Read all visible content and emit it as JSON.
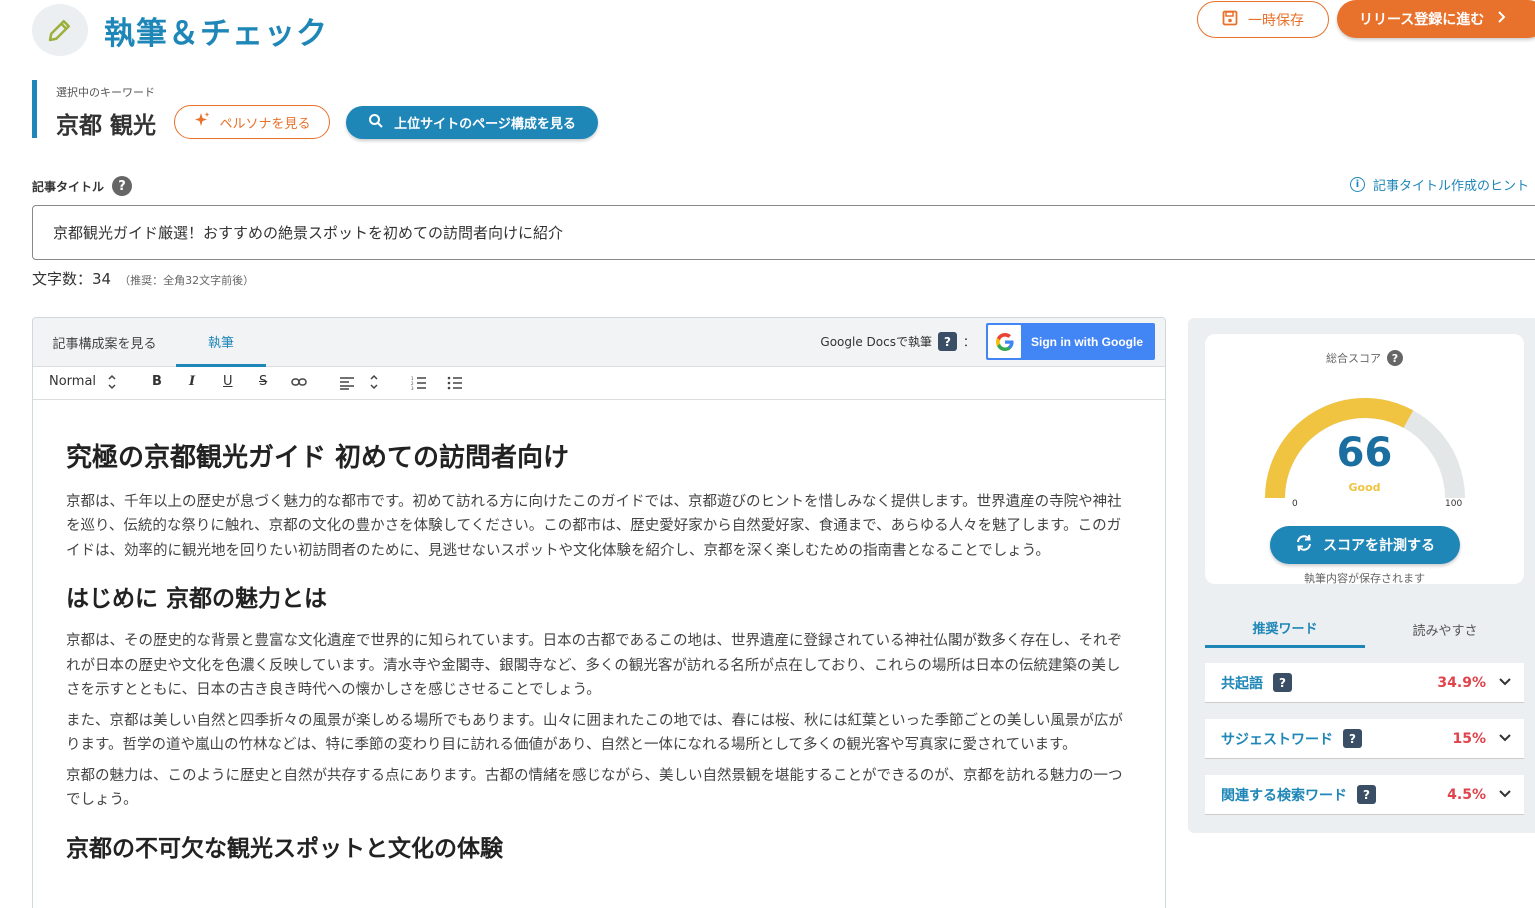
{
  "header": {
    "title": "執筆＆チェック",
    "save_label": "一時保存",
    "release_label": "リリース登録に進む"
  },
  "keyword": {
    "label": "選択中のキーワード",
    "value": "京都 観光",
    "persona_button": "ペルソナを見る",
    "structure_button": "上位サイトのページ構成を見る"
  },
  "title_field": {
    "label": "記事タイトル",
    "help": "?",
    "hint_link": "記事タイトル作成のヒント",
    "value": "京都観光ガイド厳選！おすすめの絶景スポットを初めての訪問者向けに紹介",
    "count_label": "文字数：34",
    "count_note": "（推奨：全角32文字前後）"
  },
  "editor": {
    "tabs": [
      "記事構成案を見る",
      "執筆"
    ],
    "gdocs_label": "Google Docsで執筆",
    "gdocs_help": "?",
    "gdocs_colon": "：",
    "google_signin": "Sign in with Google",
    "toolbar": {
      "style": "Normal",
      "bold": "B",
      "italic": "I",
      "underline": "U",
      "strike": "S"
    },
    "content": {
      "h1": "究極の京都観光ガイド 初めての訪問者向け",
      "p1": "京都は、千年以上の歴史が息づく魅力的な都市です。初めて訪れる方に向けたこのガイドでは、京都遊びのヒントを惜しみなく提供します。世界遺産の寺院や神社を巡り、伝統的な祭りに触れ、京都の文化の豊かさを体験してください。この都市は、歴史愛好家から自然愛好家、食通まで、あらゆる人々を魅了します。このガイドは、効率的に観光地を回りたい初訪問者のために、見逃せないスポットや文化体験を紹介し、京都を深く楽しむための指南書となることでしょう。",
      "h2": "はじめに 京都の魅力とは",
      "p2": "京都は、その歴史的な背景と豊富な文化遺産で世界的に知られています。日本の古都であるこの地は、世界遺産に登録されている神社仏閣が数多く存在し、それぞれが日本の歴史や文化を色濃く反映しています。清水寺や金閣寺、銀閣寺など、多くの観光客が訪れる名所が点在しており、これらの場所は日本の伝統建築の美しさを示すとともに、日本の古き良き時代への懐かしさを感じさせることでしょう。",
      "p3": "また、京都は美しい自然と四季折々の風景が楽しめる場所でもあります。山々に囲まれたこの地では、春には桜、秋には紅葉といった季節ごとの美しい風景が広がります。哲学の道や嵐山の竹林などは、特に季節の変わり目に訪れる価値があり、自然と一体になれる場所として多くの観光客や写真家に愛されています。",
      "p4": "京都の魅力は、このように歴史と自然が共存する点にあります。古都の情緒を感じながら、美しい自然景観を堪能することができるのが、京都を訪れる魅力の一つでしょう。",
      "h2b": "京都の不可欠な観光スポットと文化の体験"
    }
  },
  "score": {
    "label": "総合スコア",
    "help": "?",
    "value": 66,
    "display": "66",
    "grade": "Good",
    "min_label": "0",
    "max_label": "100",
    "measure_button": "スコアを計測する",
    "saved_note": "執筆内容が保存されます",
    "colors": {
      "fill": "#f0c341",
      "track": "#e3e7e8"
    }
  },
  "side_tabs": [
    "推奨ワード",
    "読みやすさ"
  ],
  "word_groups": [
    {
      "label": "共起語",
      "help": "?",
      "percent": "34.9%"
    },
    {
      "label": "サジェストワード",
      "help": "?",
      "percent": "15%"
    },
    {
      "label": "関連する検索ワード",
      "help": "?",
      "percent": "4.5%"
    }
  ]
}
